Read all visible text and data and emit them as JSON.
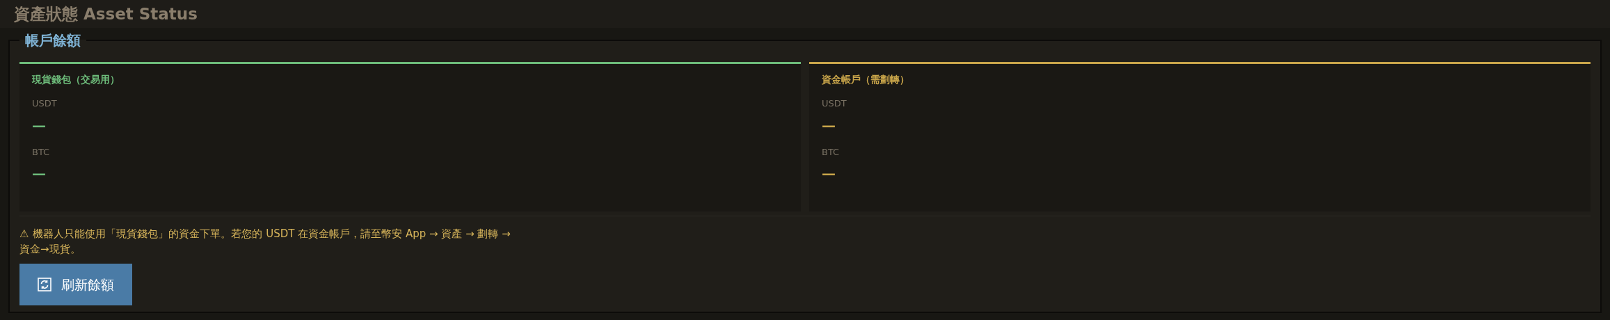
{
  "title": "資產狀態 Asset Status",
  "section": {
    "legend": "帳戶餘額",
    "cards": [
      {
        "title": "現貨錢包（交易用）",
        "color": "#6dbb7a",
        "rows": [
          {
            "label": "USDT",
            "value": "—"
          },
          {
            "label": "BTC",
            "value": "—"
          }
        ]
      },
      {
        "title": "資金帳戶（需劃轉）",
        "color": "#c9a54a",
        "rows": [
          {
            "label": "USDT",
            "value": "—"
          },
          {
            "label": "BTC",
            "value": "—"
          }
        ]
      }
    ],
    "warning": {
      "icon": "⚠",
      "text": "機器人只能使用「現貨錢包」的資金下單。若您的 USDT 在資金帳戶，請至幣安 App → 資產 → 劃轉 → 資金→現貨。"
    },
    "button": "刷新餘額"
  }
}
